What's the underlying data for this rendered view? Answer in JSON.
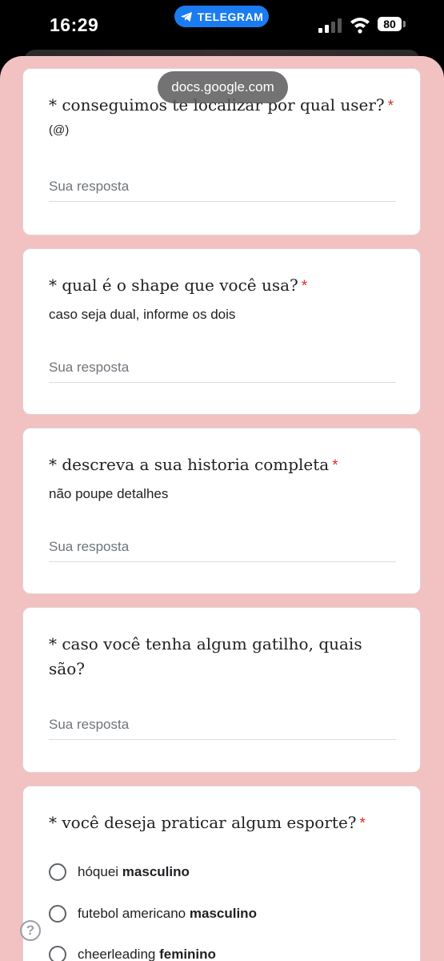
{
  "status_bar": {
    "time": "16:29",
    "telegram_label": "TELEGRAM",
    "battery": "80"
  },
  "url_bar": {
    "url": "docs.google.com"
  },
  "questions": [
    {
      "title": "* conseguimos te localizar por qual user?",
      "required_mark": "*",
      "description": "(@)",
      "answer_placeholder": "Sua resposta"
    },
    {
      "title": "* qual é o shape que você usa?",
      "required_mark": "*",
      "description": "caso seja dual, informe os dois",
      "answer_placeholder": "Sua resposta"
    },
    {
      "title": "* descreva a sua historia completa",
      "required_mark": "*",
      "description": "não poupe detalhes",
      "answer_placeholder": "Sua resposta"
    },
    {
      "title": "* caso você tenha algum gatilho, quais são?",
      "required_mark": "",
      "description": "",
      "answer_placeholder": "Sua resposta"
    },
    {
      "title": "* você deseja praticar algum esporte?",
      "required_mark": "*",
      "description": "",
      "options": [
        {
          "label": "hóquei",
          "bold": "masculino"
        },
        {
          "label": "futebol americano",
          "bold": "masculino"
        },
        {
          "label": "cheerleading",
          "bold": "feminino"
        }
      ]
    }
  ],
  "help": {
    "label": "?"
  },
  "colors": {
    "page_bg": "#f2c1c2",
    "required": "#d93025",
    "telegram": "#1a7cf0"
  }
}
